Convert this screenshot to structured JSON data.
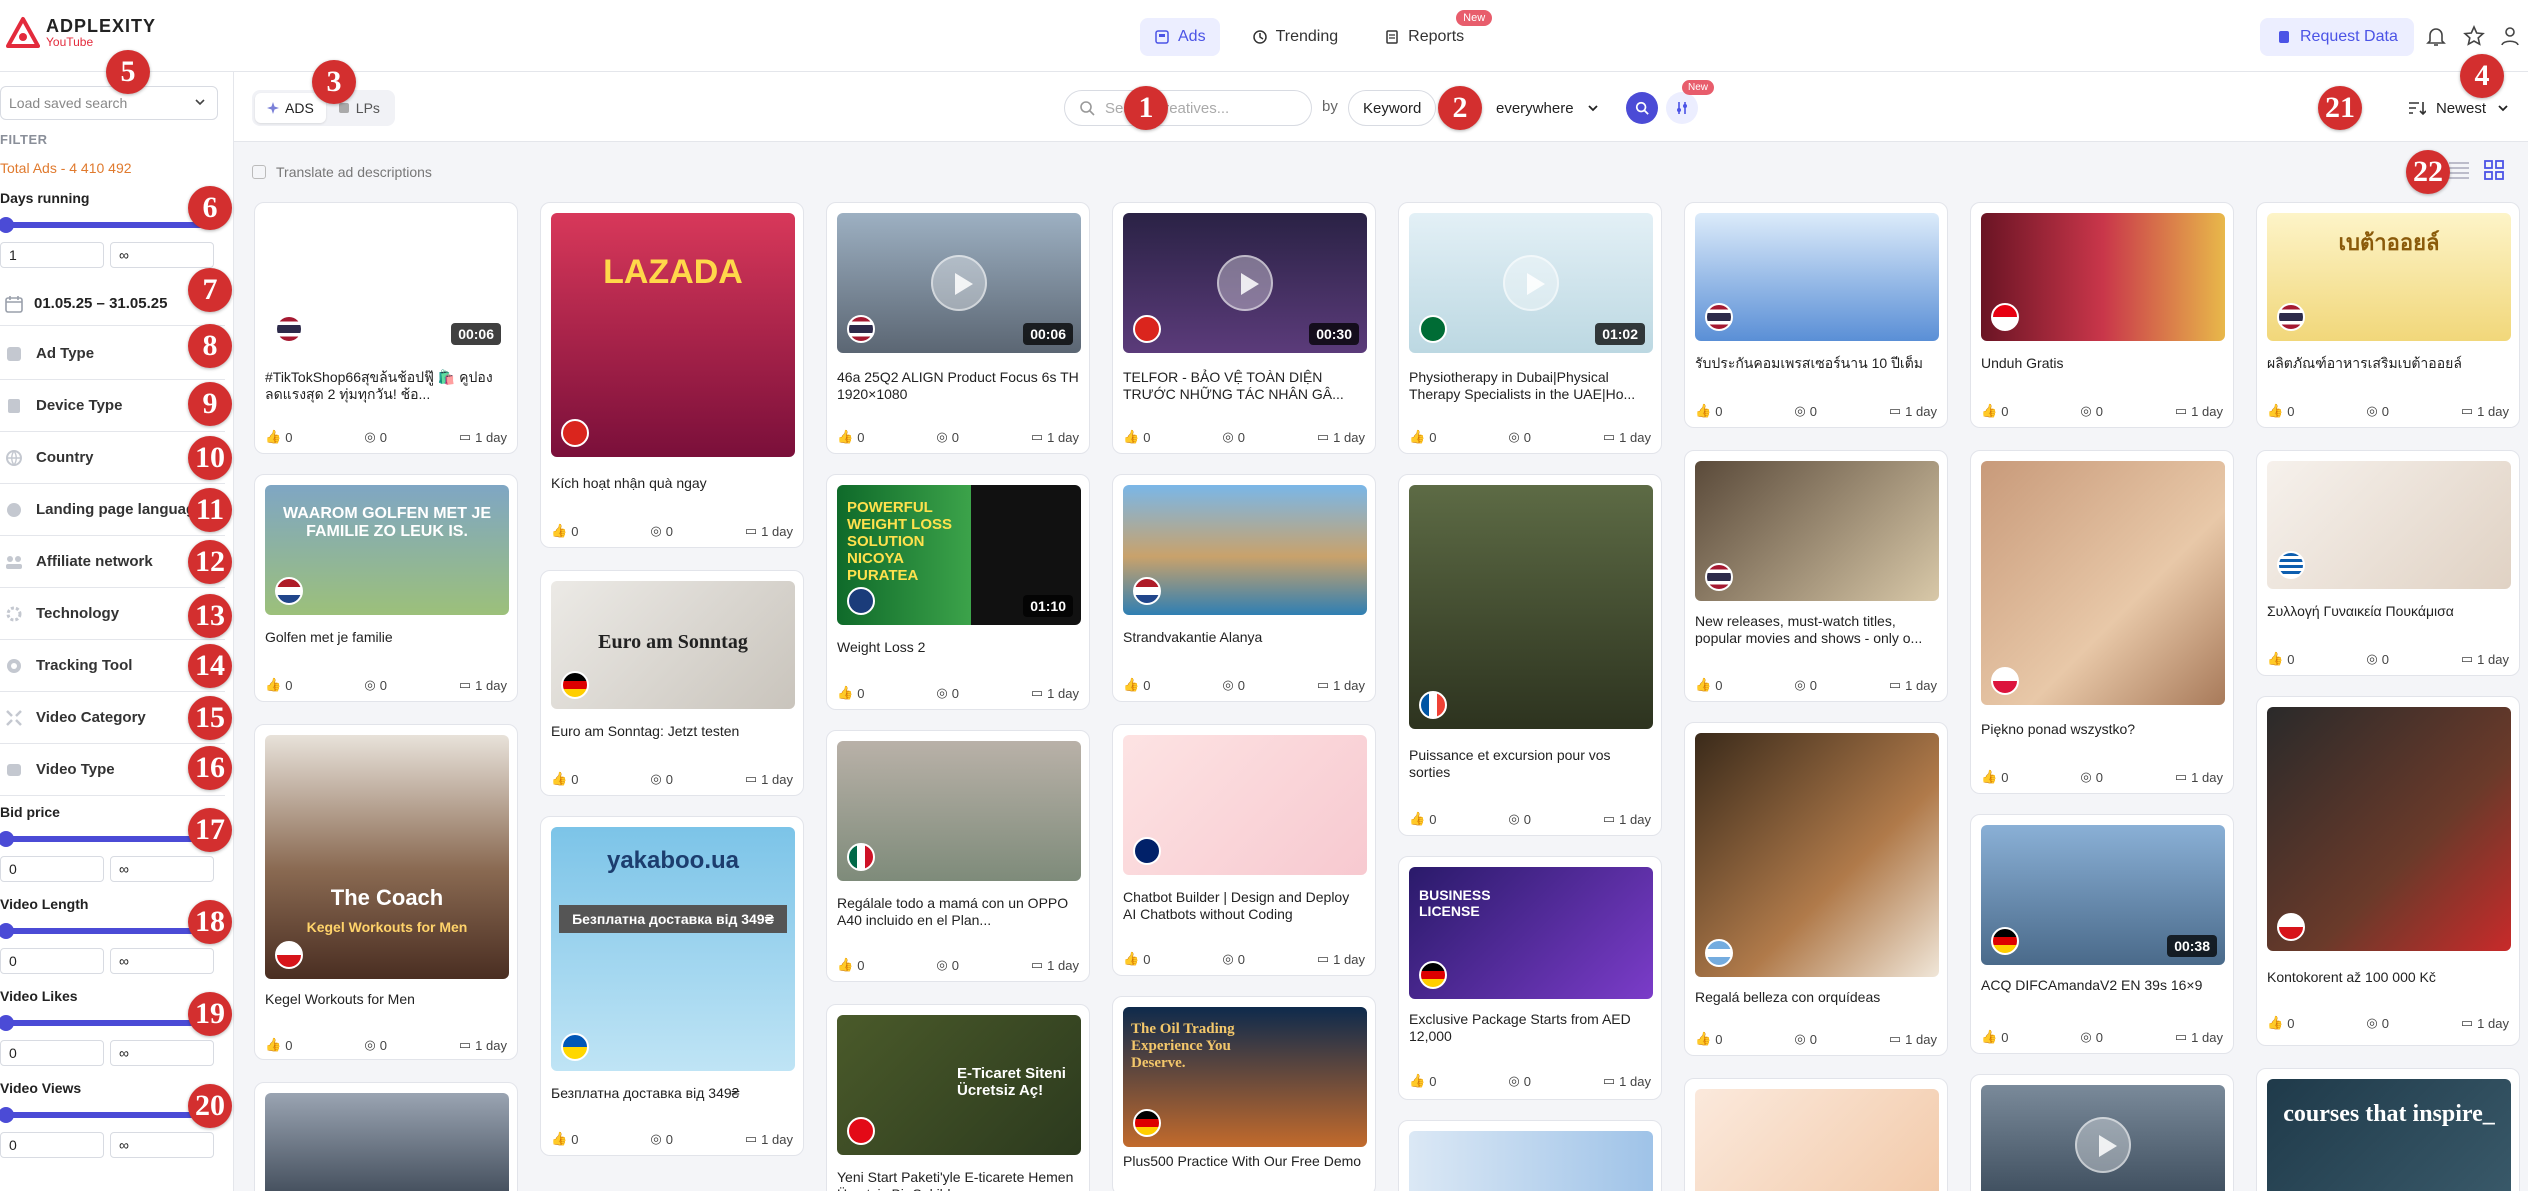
{
  "brand": {
    "name": "ADPLEXITY",
    "sub": "YouTube"
  },
  "nav": [
    {
      "label": "Ads",
      "active": true,
      "icon": "ad-icon"
    },
    {
      "label": "Trending",
      "icon": "clock-icon"
    },
    {
      "label": "Reports",
      "icon": "report-icon",
      "badge": "New"
    }
  ],
  "header": {
    "request_label": "Request Data"
  },
  "sidebar": {
    "saved_placeholder": "Load saved search",
    "filter_title": "FILTER",
    "total": "Total Ads - 4 410 492",
    "days_running": {
      "label": "Days running",
      "min": "1",
      "max": "∞"
    },
    "date_range": "01.05.25 – 31.05.25",
    "items": [
      "Ad Type",
      "Device Type",
      "Country",
      "Landing page language",
      "Affiliate network",
      "Technology",
      "Tracking Tool",
      "Video Category",
      "Video Type"
    ],
    "bid_price": {
      "label": "Bid price",
      "min": "0",
      "max": "∞"
    },
    "video_length": {
      "label": "Video Length",
      "min": "0",
      "max": "∞"
    },
    "video_likes": {
      "label": "Video Likes",
      "min": "0",
      "max": "∞"
    },
    "video_views": {
      "label": "Video Views",
      "min": "0",
      "max": "∞"
    }
  },
  "toolbar": {
    "tabs": [
      "ADS",
      "LPs"
    ],
    "search_placeholder": "Search creatives...",
    "by": "by",
    "keyword": "Keyword",
    "where": "everywhere",
    "filter_badge": "New",
    "sort": "Newest"
  },
  "translate_label": "Translate ad descriptions",
  "markers": [
    "1",
    "2",
    "3",
    "4",
    "5",
    "6",
    "7",
    "8",
    "9",
    "10",
    "11",
    "12",
    "13",
    "14",
    "15",
    "16",
    "17",
    "18",
    "19",
    "20",
    "21",
    "22"
  ],
  "cards": [
    {
      "title": "#TikTokShop66สุขล้นช้อปฟู๊ 🛍️ คูปองลดแรงสุด 2 ทุ่มทุกวัน! ช้อ...",
      "likes": "0",
      "views": "0",
      "age": "1 day",
      "duration": "00:06"
    },
    {
      "title": "Golfen met je familie",
      "likes": "0",
      "views": "0",
      "age": "1 day"
    },
    {
      "title": "Kegel Workouts for Men",
      "likes": "0",
      "views": "0",
      "age": "1 day"
    },
    {
      "title": "Kích hoạt nhận quà ngay",
      "likes": "0",
      "views": "0",
      "age": "1 day"
    },
    {
      "title": "Euro am Sonntag: Jetzt testen",
      "likes": "0",
      "views": "0",
      "age": "1 day"
    },
    {
      "title": "Безплатна доставка від 349₴",
      "likes": "0",
      "views": "0",
      "age": "1 day"
    },
    {
      "title": "46a 25Q2 ALIGN Product Focus 6s TH 1920×1080",
      "likes": "0",
      "views": "0",
      "age": "1 day",
      "duration": "00:06"
    },
    {
      "title": "Weight Loss 2",
      "likes": "0",
      "views": "0",
      "age": "1 day",
      "duration": "01:10"
    },
    {
      "title": "Regálale todo a mamá con un OPPO A40 incluido en el Plan...",
      "likes": "0",
      "views": "0",
      "age": "1 day"
    },
    {
      "title": "Yeni Start Paketi'yle E-ticarete Hemen Ücretsiz Bir Şekilde...",
      "likes": "",
      "views": "",
      "age": ""
    },
    {
      "title": "TELFOR - BẢO VỆ TOÀN DIỆN TRƯỚC NHỮNG TÁC NHÂN GÂ...",
      "likes": "0",
      "views": "0",
      "age": "1 day",
      "duration": "00:30"
    },
    {
      "title": "Strandvakantie Alanya",
      "likes": "0",
      "views": "0",
      "age": "1 day"
    },
    {
      "title": "Chatbot Builder | Design and Deploy AI Chatbots without Coding",
      "likes": "0",
      "views": "0",
      "age": "1 day"
    },
    {
      "title": "Plus500 Practice With Our Free Demo",
      "likes": "",
      "views": "",
      "age": ""
    },
    {
      "title": "Physiotherapy in Dubai|Physical Therapy Specialists in the UAE|Ho...",
      "likes": "0",
      "views": "0",
      "age": "1 day",
      "duration": "01:02"
    },
    {
      "title": "Puissance et excursion pour vos sorties",
      "likes": "0",
      "views": "0",
      "age": "1 day"
    },
    {
      "title": "Exclusive Package Starts from AED 12,000",
      "likes": "0",
      "views": "0",
      "age": "1 day"
    },
    {
      "title": "รับประกันคอมเพรสเซอร์นาน 10 ปีเต็ม",
      "likes": "0",
      "views": "0",
      "age": "1 day"
    },
    {
      "title": "New releases, must-watch titles, popular movies and shows - only o...",
      "likes": "0",
      "views": "0",
      "age": "1 day"
    },
    {
      "title": "Regalá belleza con orquídeas",
      "likes": "0",
      "views": "0",
      "age": "1 day"
    },
    {
      "title": "Unduh Gratis",
      "likes": "0",
      "views": "0",
      "age": "1 day"
    },
    {
      "title": "Piękno ponad wszystko?",
      "likes": "0",
      "views": "0",
      "age": "1 day"
    },
    {
      "title": "ACQ DIFCAmandaV2 EN 39s 16×9",
      "likes": "0",
      "views": "0",
      "age": "1 day",
      "duration": "00:38"
    },
    {
      "title": "ผลิตภัณฑ์อาหารเสริมเบต้าออยล์",
      "likes": "0",
      "views": "0",
      "age": "1 day"
    },
    {
      "title": "Συλλογή Γυναικεία Πουκάμισα",
      "likes": "0",
      "views": "0",
      "age": "1 day"
    },
    {
      "title": "Kontokorent až 100 000 Kč",
      "likes": "0",
      "views": "0",
      "age": "1 day"
    }
  ],
  "thumb_texts": {
    "lazada": "LAZADA",
    "euro": "Euro am Sonntag",
    "yakaboo": "yakaboo.ua",
    "yak_sub": "Безплатна доставка від 349₴",
    "weightloss": "POWERFUL WEIGHT LOSS SOLUTION NICOYA PURATEA",
    "coach": "The Coach",
    "coach_sub": "Kegel Workouts for Men",
    "golf": "WAAROM GOLFEN MET JE FAMILIE ZO LEUK IS.",
    "ikas": "E-Ticaret Siteni Ücretsiz Aç!",
    "oil": "The Oil Trading Experience You Deserve.",
    "license": "BUSINESS LICENSE",
    "courses": "courses that inspire_",
    "beta": "เบต้าออยล์"
  }
}
